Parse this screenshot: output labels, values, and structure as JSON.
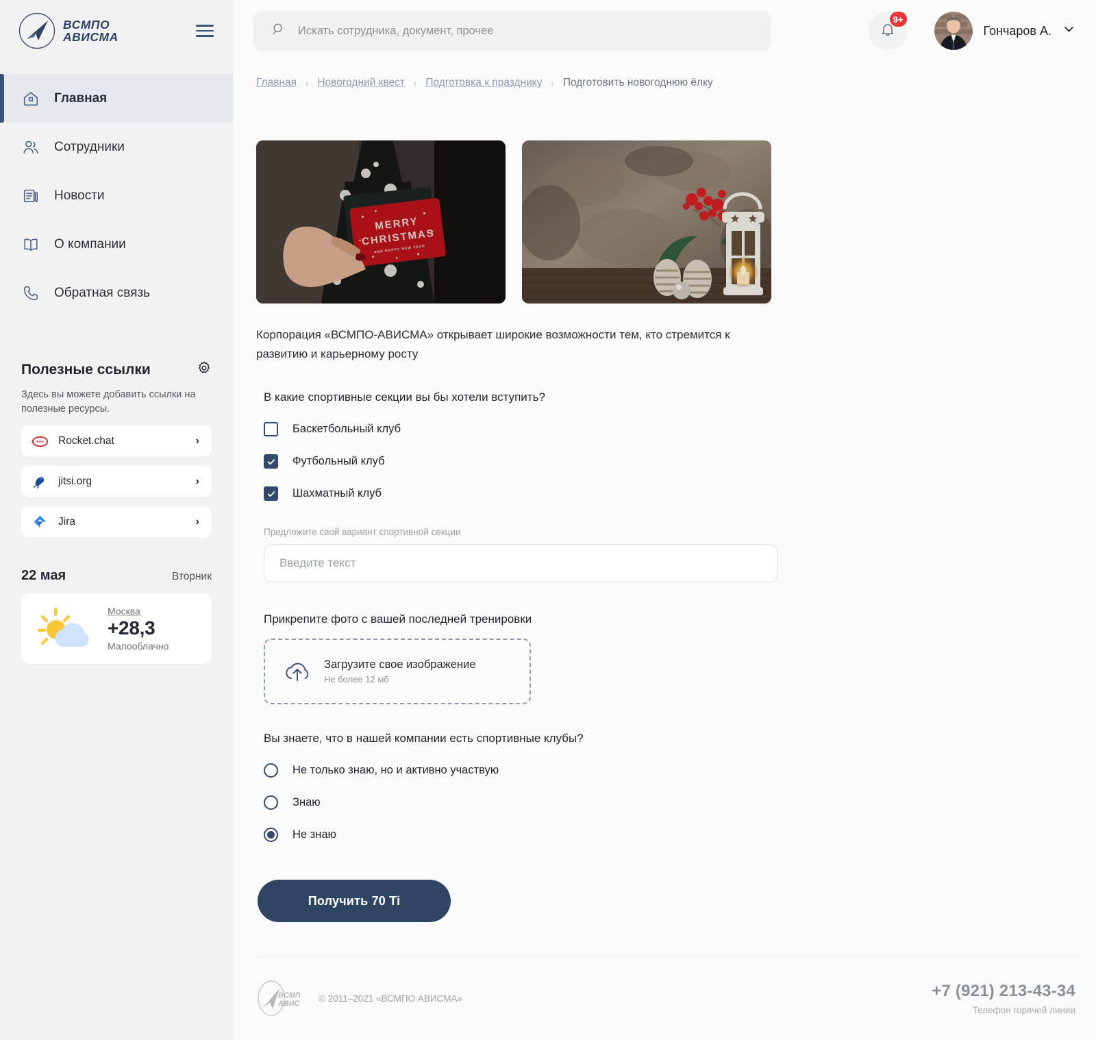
{
  "brand": {
    "line1": "ВСМПО",
    "line2": "АВИСМА",
    "logo_icon": "vsmpo-avisma-logo-icon",
    "burger_icon": "hamburger-menu-icon"
  },
  "sidebar": {
    "nav": [
      {
        "label": "Главная",
        "icon": "home-icon",
        "active": true
      },
      {
        "label": "Сотрудники",
        "icon": "users-icon",
        "active": false
      },
      {
        "label": "Новости",
        "icon": "news-icon",
        "active": false
      },
      {
        "label": "О компании",
        "icon": "book-icon",
        "active": false
      },
      {
        "label": "Обратная связь",
        "icon": "phone-icon",
        "active": false
      }
    ],
    "links": {
      "title": "Полезные ссылки",
      "settings_icon": "gear-icon",
      "subtitle": "Здесь вы можете добавить ссылки на полезные ресурсы.",
      "items": [
        {
          "label": "Rocket.chat",
          "icon": "rocketchat-icon",
          "chevron": "›"
        },
        {
          "label": "jitsi.org",
          "icon": "jitsi-icon",
          "chevron": "›"
        },
        {
          "label": "Jira",
          "icon": "jira-icon",
          "chevron": "›"
        }
      ]
    },
    "weather": {
      "date": "22 мая",
      "weekday": "Вторник",
      "city": "Москва",
      "temp": "+28,3",
      "condition": "Малооблачно",
      "icon": "sun-cloud-icon"
    }
  },
  "header": {
    "search": {
      "placeholder": "Искать сотрудника, документ, прочее",
      "icon": "search-icon",
      "value": ""
    },
    "notifications": {
      "icon": "bell-icon",
      "badge": "9+",
      "badge_color": "#e8353a"
    },
    "user": {
      "name": "Гончаров А.",
      "avatar": "user-avatar",
      "chevron": "⌄"
    }
  },
  "breadcrumb": {
    "items": [
      {
        "label": "Главная",
        "link": true
      },
      {
        "label": "Новогодний квест",
        "link": true
      },
      {
        "label": "Подготовка к празднику",
        "link": true
      },
      {
        "label": "Подготовить новогоднюю ёлку",
        "link": false
      }
    ],
    "separator": "›"
  },
  "main": {
    "photos": [
      {
        "alt": "Рука держит красную открытку Merry Christmas у ёлки",
        "caption": "MERRY CHRISTMAS"
      },
      {
        "alt": "Белый фонарь со свечой, шишки и красные ягоды"
      }
    ],
    "intro": "Корпорация «ВСМПО-АВИСМА» открывает широкие возможности тем, кто стремится к развитию и карьерному росту",
    "checkbox_question": {
      "title": "В какие спортивные секции вы бы хотели вступить?",
      "options": [
        {
          "label": "Баскетбольный клуб",
          "checked": false
        },
        {
          "label": "Футбольный клуб",
          "checked": true
        },
        {
          "label": "Шахматный клуб",
          "checked": true
        }
      ]
    },
    "custom_field": {
      "label": "Предложите свой вариант спортивной секции",
      "placeholder": "Введите текст",
      "value": ""
    },
    "upload": {
      "label": "Прикрепите фото с вашей последней тренировки",
      "title": "Загрузите свое изображение",
      "hint": "Не более 12 мб",
      "icon": "cloud-upload-icon"
    },
    "radio_question": {
      "title": "Вы знаете, что в нашей компании есть спортивные клубы?",
      "options": [
        {
          "label": "Не только знаю, но и активно участвую",
          "selected": false
        },
        {
          "label": "Знаю",
          "selected": false
        },
        {
          "label": "Не знаю",
          "selected": true
        }
      ]
    },
    "submit_label": "Получить 70 Ti"
  },
  "footer": {
    "logo": "vsmpo-avisma-logo-icon",
    "copyright": "© 2011–2021 «ВСМПО АВИСМА»",
    "phone": "+7 (921) 213-43-34",
    "hotline": "Телефон горячей линии"
  },
  "colors": {
    "navy": "#2e4664",
    "navy_light": "#33496b",
    "badge_red": "#e8353a",
    "sidebar_bg": "#f2f2f2",
    "active_bg": "#e5e8ed"
  }
}
